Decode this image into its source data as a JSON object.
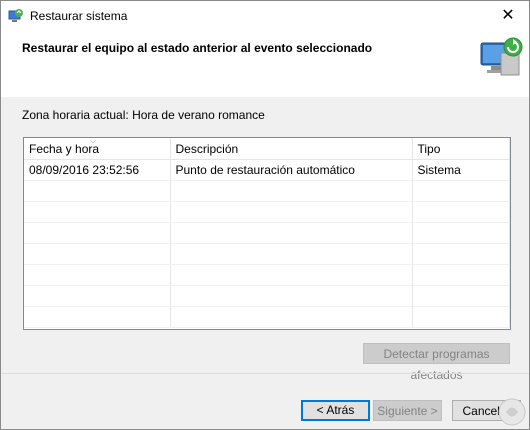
{
  "window": {
    "title": "Restaurar sistema",
    "close_glyph": "✕"
  },
  "header": {
    "heading": "Restaurar el equipo al estado anterior al evento seleccionado",
    "icon": "computer-restore-icon"
  },
  "timezone_label": "Zona horaria actual: Hora de verano romance",
  "list": {
    "columns": [
      "Fecha y hora",
      "Descripción",
      "Tipo"
    ],
    "rows": [
      [
        "08/09/2016 23:52:56",
        "Punto de restauración automático",
        "Sistema"
      ]
    ]
  },
  "buttons": {
    "scan": "Detectar programas afectados",
    "back": "< Atrás",
    "next": "Siguiente >",
    "cancel": "Cancelar"
  },
  "colors": {
    "accent": "#0078d7"
  }
}
